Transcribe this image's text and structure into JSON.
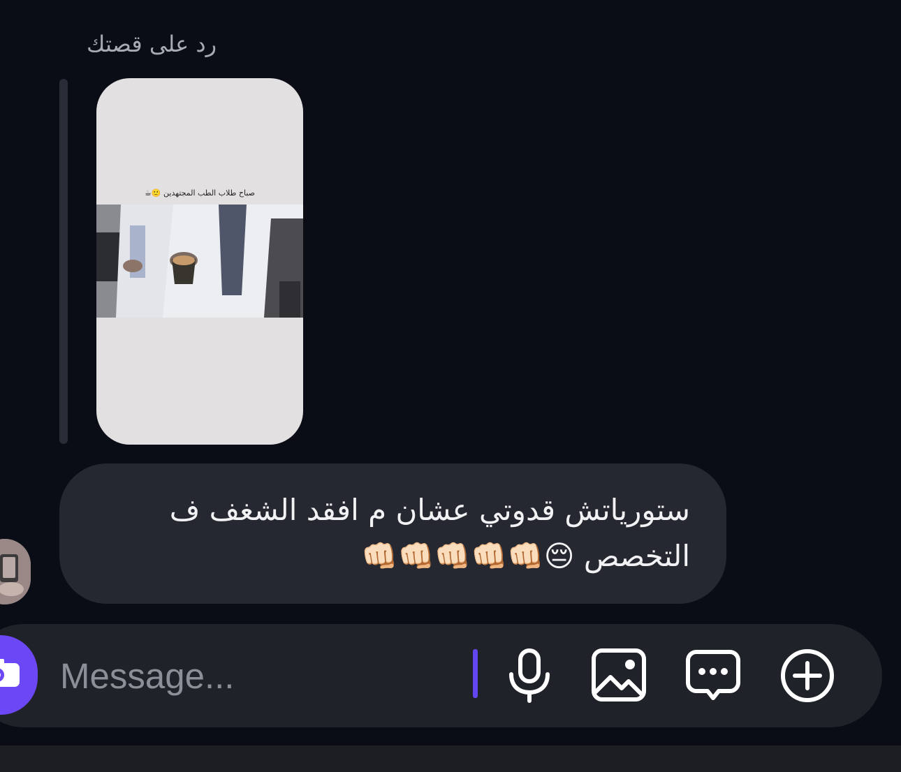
{
  "reply": {
    "caption": "رد على قصتك",
    "story_caption": "صباح طلاب الطب المجتهدين 🙂☕"
  },
  "message": {
    "text": "ستورياتش قدوتي عشان م افقد الشغف ف التخصص 😔👊🏻👊🏻👊🏻👊🏻👊🏻"
  },
  "composer": {
    "placeholder": "Message...",
    "camera_icon": "camera-icon",
    "mic_icon": "microphone-icon",
    "gallery_icon": "image-icon",
    "chat_icon": "chat-bubble-icon",
    "plus_icon": "plus-circle-icon"
  },
  "colors": {
    "background": "#0b0d16",
    "bubble": "#262831",
    "composer": "#202229",
    "accent": "#6c47f5"
  }
}
